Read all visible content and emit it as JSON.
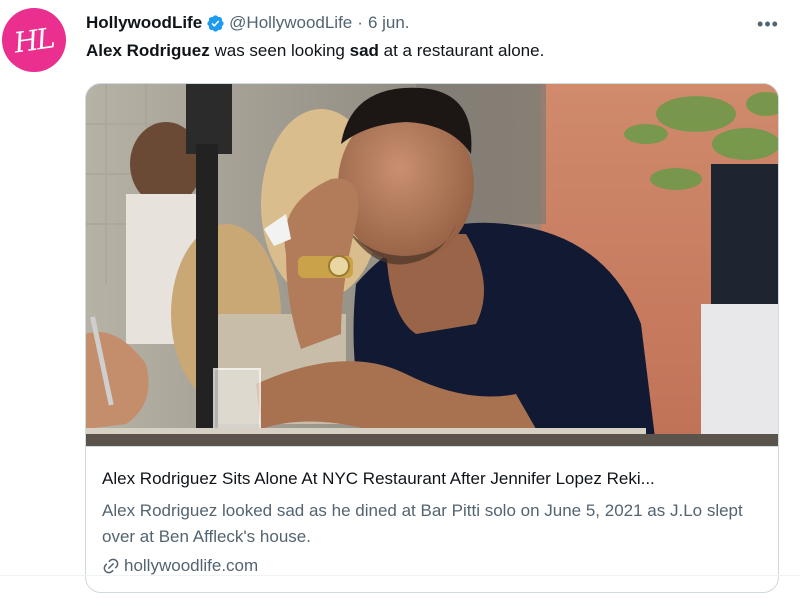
{
  "tweet": {
    "avatar_text": "HL",
    "display_name": "HollywoodLife",
    "handle": "@HollywoodLife",
    "separator": "·",
    "date": "6 jun.",
    "more": "•••",
    "text_parts": [
      "Alex Rodriguez",
      " was seen looking ",
      "sad",
      " at a restaurant alone."
    ]
  },
  "card": {
    "title": "Alex Rodriguez Sits Alone At NYC Restaurant After Jennifer Lopez Reki...",
    "description": "Alex Rodriguez looked sad as he dined at Bar Pitti solo on June 5, 2021 as J.Lo slept over at Ben Affleck's house.",
    "link_text": "hollywoodlife.com"
  },
  "colors": {
    "avatar_bg": "#ea2f8f",
    "verified": "#1d9bf0",
    "secondary_text": "#536471",
    "border": "#cfd9de"
  },
  "icons": [
    "verified-badge-icon",
    "more-options-icon",
    "link-icon"
  ]
}
